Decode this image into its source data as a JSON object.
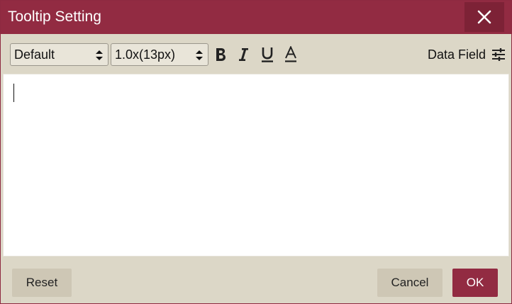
{
  "dialog": {
    "title": "Tooltip Setting",
    "close_icon": "close-icon"
  },
  "toolbar": {
    "font_family": {
      "selected": "Default",
      "icon": "up-down-arrows-icon"
    },
    "font_size": {
      "selected": "1.0x(13px)",
      "icon": "up-down-arrows-icon"
    },
    "format_buttons": [
      {
        "name": "bold",
        "glyph": "B",
        "icon": "bold-icon"
      },
      {
        "name": "italic",
        "glyph": "I",
        "icon": "italic-icon"
      },
      {
        "name": "underline",
        "glyph": "U",
        "icon": "underline-icon"
      },
      {
        "name": "font-color",
        "glyph": "A",
        "icon": "font-color-icon"
      }
    ],
    "data_field": {
      "label": "Data Field",
      "icon": "sliders-icon"
    }
  },
  "editor": {
    "content": ""
  },
  "footer": {
    "reset_label": "Reset",
    "cancel_label": "Cancel",
    "ok_label": "OK"
  },
  "colors": {
    "accent": "#922b42",
    "accent_dark": "#7d2236",
    "panel": "#dcd7c7",
    "button_neutral": "#cec7b5"
  }
}
